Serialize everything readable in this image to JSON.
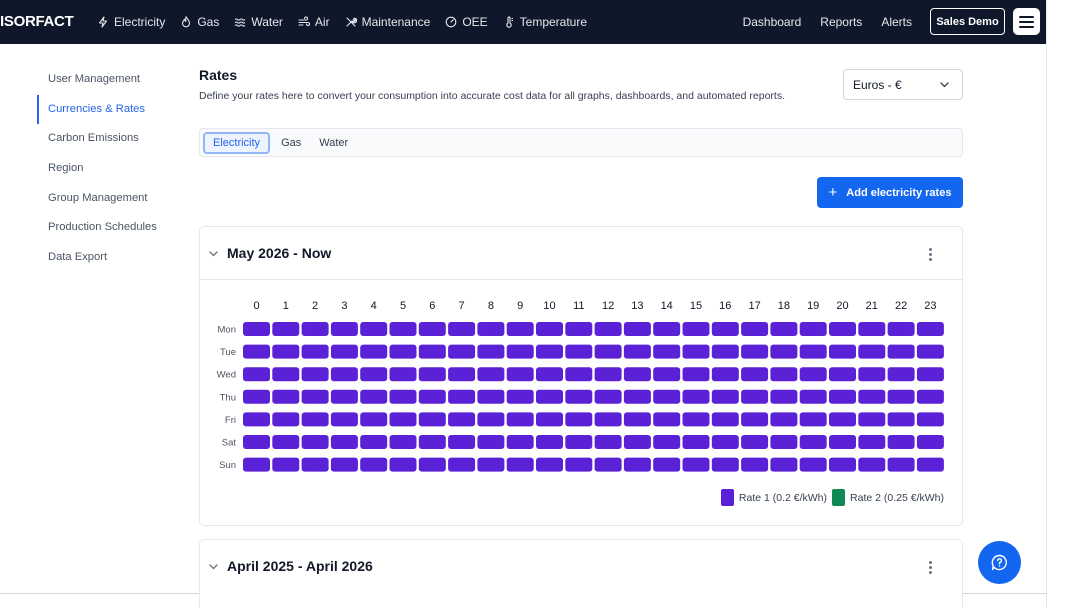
{
  "brand": {
    "logo_text": "ISORFACT"
  },
  "nav": {
    "items": [
      {
        "label": "Electricity",
        "icon": "bolt-icon"
      },
      {
        "label": "Gas",
        "icon": "flame-icon"
      },
      {
        "label": "Water",
        "icon": "waves-icon"
      },
      {
        "label": "Air",
        "icon": "wind-icon"
      },
      {
        "label": "Maintenance",
        "icon": "tools-icon"
      },
      {
        "label": "OEE",
        "icon": "gauge-icon"
      },
      {
        "label": "Temperature",
        "icon": "thermometer-icon"
      }
    ],
    "right": [
      "Dashboard",
      "Reports",
      "Alerts"
    ],
    "account_button": "Sales Demo"
  },
  "sidebar": {
    "items": [
      {
        "label": "User Management",
        "active": false
      },
      {
        "label": "Currencies & Rates",
        "active": true
      },
      {
        "label": "Carbon Emissions",
        "active": false
      },
      {
        "label": "Region",
        "active": false
      },
      {
        "label": "Group Management",
        "active": false
      },
      {
        "label": "Production Schedules",
        "active": false
      },
      {
        "label": "Data Export",
        "active": false
      }
    ]
  },
  "rates": {
    "title": "Rates",
    "description": "Define your rates here to convert your consumption into accurate cost data for all graphs, dashboards, and automated reports.",
    "currency": "Euros - €",
    "tabs": [
      {
        "label": "Electricity",
        "active": true
      },
      {
        "label": "Gas",
        "active": false
      },
      {
        "label": "Water",
        "active": false
      }
    ],
    "add_button": "Add electricity rates"
  },
  "periods": [
    {
      "title": "May 2026 - Now",
      "expanded": true
    },
    {
      "title": "April 2025 - April 2026",
      "expanded": true
    }
  ],
  "chart_data": {
    "type": "heatmap",
    "x": [
      "0",
      "1",
      "2",
      "3",
      "4",
      "5",
      "6",
      "7",
      "8",
      "9",
      "10",
      "11",
      "12",
      "13",
      "14",
      "15",
      "16",
      "17",
      "18",
      "19",
      "20",
      "21",
      "22",
      "23"
    ],
    "y": [
      "Mon",
      "Tue",
      "Wed",
      "Thu",
      "Fri",
      "Sat",
      "Sun"
    ],
    "values": [
      [
        1,
        1,
        1,
        1,
        1,
        1,
        1,
        1,
        1,
        1,
        1,
        1,
        1,
        1,
        1,
        1,
        1,
        1,
        1,
        1,
        1,
        1,
        1,
        1
      ],
      [
        1,
        1,
        1,
        1,
        1,
        1,
        1,
        1,
        1,
        1,
        1,
        1,
        1,
        1,
        1,
        1,
        1,
        1,
        1,
        1,
        1,
        1,
        1,
        1
      ],
      [
        1,
        1,
        1,
        1,
        1,
        1,
        1,
        1,
        1,
        1,
        1,
        1,
        1,
        1,
        1,
        1,
        1,
        1,
        1,
        1,
        1,
        1,
        1,
        1
      ],
      [
        1,
        1,
        1,
        1,
        1,
        1,
        1,
        1,
        1,
        1,
        1,
        1,
        1,
        1,
        1,
        1,
        1,
        1,
        1,
        1,
        1,
        1,
        1,
        1
      ],
      [
        1,
        1,
        1,
        1,
        1,
        1,
        1,
        1,
        1,
        1,
        1,
        1,
        1,
        1,
        1,
        1,
        1,
        1,
        1,
        1,
        1,
        1,
        1,
        1
      ],
      [
        1,
        1,
        1,
        1,
        1,
        1,
        1,
        1,
        1,
        1,
        1,
        1,
        1,
        1,
        1,
        1,
        1,
        1,
        1,
        1,
        1,
        1,
        1,
        1
      ],
      [
        1,
        1,
        1,
        1,
        1,
        1,
        1,
        1,
        1,
        1,
        1,
        1,
        1,
        1,
        1,
        1,
        1,
        1,
        1,
        1,
        1,
        1,
        1,
        1
      ]
    ],
    "legend": [
      {
        "name": "Rate 1 (0.2 €/kWh)",
        "value": 1,
        "color": "#5b21d6"
      },
      {
        "name": "Rate 2 (0.25 €/kWh)",
        "value": 2,
        "color": "#0f8a55"
      }
    ],
    "legend_position": "bottom-right"
  },
  "colors": {
    "topbar": "#0f172a",
    "accent": "#1366f0",
    "rate1": "#5b21d6",
    "rate2": "#0f8a55"
  },
  "help": {
    "icon": "chat-help-icon"
  }
}
